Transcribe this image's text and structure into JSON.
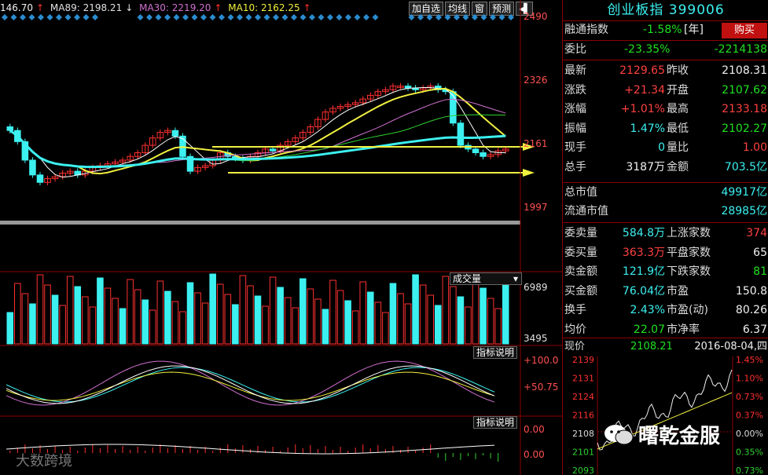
{
  "ma_bar": {
    "first": "146.70",
    "ma89_label": "MA89: 2198.21",
    "ma30_label": "MA30: 2219.20",
    "ma10_label": "MA10: 2162.25"
  },
  "toolbar": {
    "add_watchlist": "加自选",
    "ma_line": "均线",
    "window": "窗",
    "forecast": "预测",
    "exit_icon": "exit-icon"
  },
  "main_axis": {
    "top": "2490",
    "mid1": "2326",
    "mid2": "2161",
    "bottom": "1997"
  },
  "volume": {
    "dropdown": "成交量",
    "top": "6989",
    "mid": "3495"
  },
  "indicator1": {
    "explain": "指标说明",
    "top": "+100.0",
    "mid": "+50.75"
  },
  "indicator2": {
    "explain": "指标说明",
    "top": "0.00",
    "mid": "0.00"
  },
  "quote": {
    "title": "创业板指 399006",
    "margin_label": "融通指数",
    "margin_value": "-1.58%",
    "margin_unit": "[年]",
    "buy_button": "购买",
    "weibi_label": "委比",
    "weibi_pct": "-23.35%",
    "weibi_diff": "-2214138",
    "rows": [
      {
        "l1": "最新",
        "v1": "2129.65",
        "c1": "red",
        "l2": "昨收",
        "v2": "2108.31",
        "c2": "white"
      },
      {
        "l1": "涨跌",
        "v1": "+21.34",
        "c1": "red",
        "l2": "开盘",
        "v2": "2107.62",
        "c2": "green"
      },
      {
        "l1": "涨幅",
        "v1": "+1.01%",
        "c1": "red",
        "l2": "最高",
        "v2": "2133.18",
        "c2": "red"
      },
      {
        "l1": "振幅",
        "v1": "1.47%",
        "c1": "cyan",
        "l2": "最低",
        "v2": "2102.27",
        "c2": "green"
      },
      {
        "l1": "现手",
        "v1": "0",
        "c1": "cyan",
        "l2": "量比",
        "v2": "1.00",
        "c2": "red"
      },
      {
        "l1": "总手",
        "v1": "3187万",
        "c1": "white",
        "l2": "金额",
        "v2": "703.5亿",
        "c2": "cyan"
      }
    ],
    "total_mv_label": "总市值",
    "total_mv": "49917亿",
    "float_mv_label": "流通市值",
    "float_mv": "28985亿",
    "rows2": [
      {
        "l1": "委卖量",
        "v1": "584.8万",
        "c1": "cyan",
        "l2": "上涨家数",
        "v2": "374",
        "c2": "red"
      },
      {
        "l1": "委买量",
        "v1": "363.3万",
        "c1": "red",
        "l2": "平盘家数",
        "v2": "65",
        "c2": "white"
      },
      {
        "l1": "卖金额",
        "v1": "121.9亿",
        "c1": "cyan",
        "l2": "下跌家数",
        "v2": "81",
        "c2": "green"
      },
      {
        "l1": "买金额",
        "v1": "76.04亿",
        "c1": "cyan",
        "l2": "市盈",
        "v2": "150.8",
        "c2": "white"
      },
      {
        "l1": "换手",
        "v1": "2.43%",
        "c1": "cyan",
        "l2": "市盈(动)",
        "v2": "80.26",
        "c2": "white"
      },
      {
        "l1": "均价",
        "v1": "22.07",
        "c1": "green",
        "l2": "市净率",
        "v2": "6.37",
        "c2": "white"
      }
    ]
  },
  "mini": {
    "label": "现价",
    "price": "2108.21",
    "date": "2016-08-04,四",
    "left_ticks": [
      "2139",
      "2131",
      "2124",
      "2116",
      "2108",
      "2101",
      "2093"
    ],
    "right_ticks": [
      "1.45%",
      "1.10%",
      "0.73%",
      "0.37%",
      "0.00%",
      "0.35%",
      "0.73%"
    ]
  },
  "watermark": "大数跨境",
  "brand": "曙乾金服",
  "colors": {
    "up": "#ff3030",
    "down": "#3cf0f0",
    "ma_yellow": "#f0f040",
    "ma_pink": "#d070d0",
    "ma_white": "#e0e0e0",
    "ma_green": "#30d030",
    "divider": "#8b0000"
  }
}
